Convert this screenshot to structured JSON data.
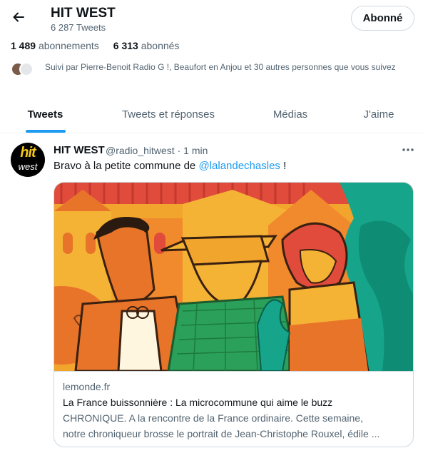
{
  "header": {
    "name": "HIT WEST",
    "tweet_count": "6 287 Tweets",
    "follow_label": "Abonné"
  },
  "stats": {
    "following_num": "1 489",
    "following_label": "abonnements",
    "followers_num": "6 313",
    "followers_label": "abonnés"
  },
  "followed_by": "Suivi par Pierre-Benoit Radio G !, Beaufort en Anjou et 30 autres personnes que vous suivez",
  "tabs": [
    {
      "label": "Tweets",
      "active": true
    },
    {
      "label": "Tweets et réponses",
      "active": false
    },
    {
      "label": "Médias",
      "active": false
    },
    {
      "label": "J'aime",
      "active": false
    }
  ],
  "tweet": {
    "avatar_top": "hit",
    "avatar_bottom": "west",
    "author": "HIT WEST",
    "handle_time": "@radio_hitwest · 1 min",
    "text_before": "Bravo à la petite commune de ",
    "mention": "@lalandechasles",
    "text_after": " !",
    "more_icon": "more-horizontal-icon"
  },
  "card": {
    "domain": "lemonde.fr",
    "title": "La France buissonnière : La microcommune qui aime le buzz",
    "description_line1": "CHRONIQUE. A la rencontre de la France ordinaire. Cette semaine,",
    "description_line2": "notre chroniqueur brosse le portrait de Jean-Christophe Rouxel, édile ..."
  },
  "colors": {
    "accent": "#1d9bf0",
    "text_primary": "#0f1419",
    "text_secondary": "#536471",
    "border": "#cfd9de"
  }
}
